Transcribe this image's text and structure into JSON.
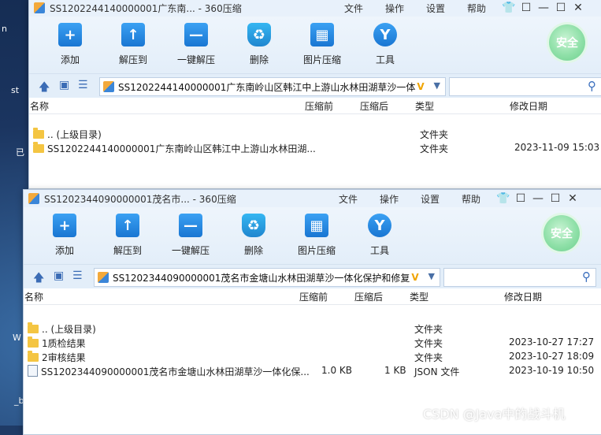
{
  "desktop": {
    "fragments": [
      "n",
      "st",
      "已",
      "W",
      "_b"
    ]
  },
  "toolbar_labels": [
    "添加",
    "解压到",
    "一键解压",
    "删除",
    "图片压缩",
    "工具"
  ],
  "menu": [
    "文件",
    "操作",
    "设置",
    "帮助"
  ],
  "safe_label": "安全",
  "columns": {
    "name": "名称",
    "compressed": "压缩前",
    "packed": "压缩后",
    "type": "类型",
    "modified": "修改日期"
  },
  "window1": {
    "title": "SS1202244140000001广东南... - 360压缩",
    "path": "SS1202244140000001广东南岭山区韩江中上游山水林田湖草沙一体",
    "path_suffix": "V",
    "rows": [
      {
        "name": ".. (上级目录)",
        "compressed": "",
        "packed": "",
        "type": "文件夹",
        "modified": ""
      },
      {
        "name": "SS1202244140000001广东南岭山区韩江中上游山水林田湖...",
        "compressed": "",
        "packed": "",
        "type": "文件夹",
        "modified": "2023-11-09 15:03"
      }
    ]
  },
  "window2": {
    "title": "SS1202344090000001茂名市... - 360压缩",
    "path": "SS1202344090000001茂名市金塘山水林田湖草沙一体化保护和修复",
    "path_suffix": "V",
    "rows": [
      {
        "name": ".. (上级目录)",
        "compressed": "",
        "packed": "",
        "type": "文件夹",
        "modified": ""
      },
      {
        "name": "1质检结果",
        "compressed": "",
        "packed": "",
        "type": "文件夹",
        "modified": "2023-10-27 17:27"
      },
      {
        "name": "2审核结果",
        "compressed": "",
        "packed": "",
        "type": "文件夹",
        "modified": "2023-10-27 18:09"
      },
      {
        "name": "SS1202344090000001茂名市金塘山水林田湖草沙一体化保...",
        "compressed": "1.0 KB",
        "packed": "1 KB",
        "type": "JSON 文件",
        "modified": "2023-10-19 10:50"
      }
    ]
  },
  "watermark": "CSDN @Java中的战斗机"
}
